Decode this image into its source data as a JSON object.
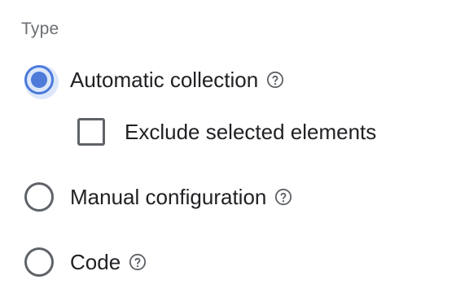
{
  "form": {
    "section_label": "Type",
    "options": [
      {
        "label": "Automatic collection",
        "selected": true,
        "has_help": true
      },
      {
        "label": "Manual configuration",
        "selected": false,
        "has_help": true
      },
      {
        "label": "Code",
        "selected": false,
        "has_help": true
      }
    ],
    "sub_option": {
      "label": "Exclude selected elements",
      "checked": false
    },
    "help_icon": "help-circle-icon"
  },
  "colors": {
    "accent": "#4e7bd9",
    "control_border": "#5f6368",
    "label_gray": "#6b6f73",
    "text": "#202124"
  }
}
